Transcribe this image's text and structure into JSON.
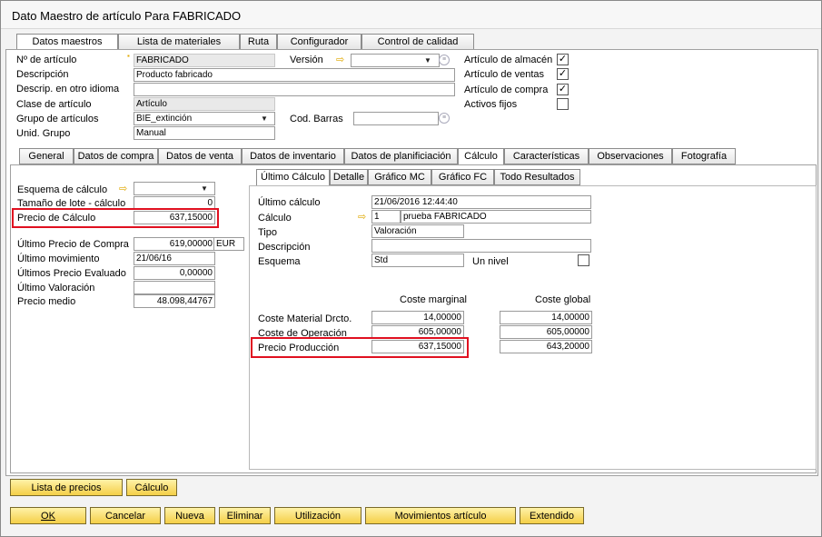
{
  "title": "Dato Maestro de artículo Para FABRICADO",
  "top_tabs": [
    "Datos maestros",
    "Lista de materiales",
    "Ruta",
    "Configurador",
    "Control de calidad"
  ],
  "header": {
    "item_no_label": "Nº de artículo",
    "item_no": "FABRICADO",
    "version_label": "Versión",
    "version_value": "",
    "description_label": "Descripción",
    "description": "Producto fabricado",
    "foreign_desc_label": "Descrip. en otro idioma",
    "foreign_desc": "",
    "item_class_label": "Clase de artículo",
    "item_class": "Artículo",
    "item_group_label": "Grupo de artículos",
    "item_group": "BIE_extinción",
    "barcode_label": "Cod. Barras",
    "barcode": "",
    "uom_group_label": "Unid. Grupo",
    "uom_group": "Manual",
    "checks": [
      {
        "label": "Artículo de almacén",
        "checked": "✓"
      },
      {
        "label": "Artículo de ventas",
        "checked": "✓"
      },
      {
        "label": "Artículo de compra",
        "checked": "✓"
      },
      {
        "label": "Activos fijos",
        "checked": ""
      }
    ]
  },
  "sub_tabs": [
    "General",
    "Datos de compra",
    "Datos de venta",
    "Datos de inventario",
    "Datos de planificiación",
    "Cálculo",
    "Características",
    "Observaciones",
    "Fotografía"
  ],
  "left": {
    "scheme_label": "Esquema de cálculo",
    "scheme": "",
    "lot_label": "Tamaño de lote - cálculo",
    "lot": "0",
    "calc_price_label": "Precio de Cálculo",
    "calc_price": "637,15000",
    "last_purchase_label": "Último Precio de Compra",
    "last_purchase": "619,00000",
    "last_purchase_cur": "EUR",
    "last_movement_label": "Último movimiento",
    "last_movement": "21/06/16",
    "last_eval_label": "Últimos Precio Evaluado",
    "last_eval": "0,00000",
    "last_valuation_label": "Último Valoración",
    "last_valuation": "",
    "avg_price_label": "Precio medio",
    "avg_price": "48.098,44767"
  },
  "inner_tabs": [
    "Último Cálculo",
    "Detalle",
    "Gráfico MC",
    "Gráfico FC",
    "Todo Resultados"
  ],
  "calc": {
    "last_calc_label": "Último cálculo",
    "last_calc": "21/06/2016 12:44:40",
    "calc_label": "Cálculo",
    "calc_no": "1",
    "calc_name": "prueba FABRICADO",
    "type_label": "Tipo",
    "type": "Valoración",
    "desc_label": "Descripción",
    "desc": "",
    "scheme_label": "Esquema",
    "scheme": "Std",
    "one_level_label": "Un nivel",
    "one_level": "",
    "col_marginal": "Coste marginal",
    "col_global": "Coste global",
    "rows": [
      {
        "label": "Coste Material Drcto.",
        "marginal": "14,00000",
        "global": "14,00000"
      },
      {
        "label": "Coste de Operación",
        "marginal": "605,00000",
        "global": "605,00000"
      },
      {
        "label": "Precio Producción",
        "marginal": "637,15000",
        "global": "643,20000"
      }
    ]
  },
  "buttons_row1": [
    "Lista de precios",
    "Cálculo"
  ],
  "buttons_row2": [
    "OK",
    "Cancelar",
    "Nueva",
    "Eliminar",
    "Utilización",
    "Movimientos artículo",
    "Extendido"
  ]
}
